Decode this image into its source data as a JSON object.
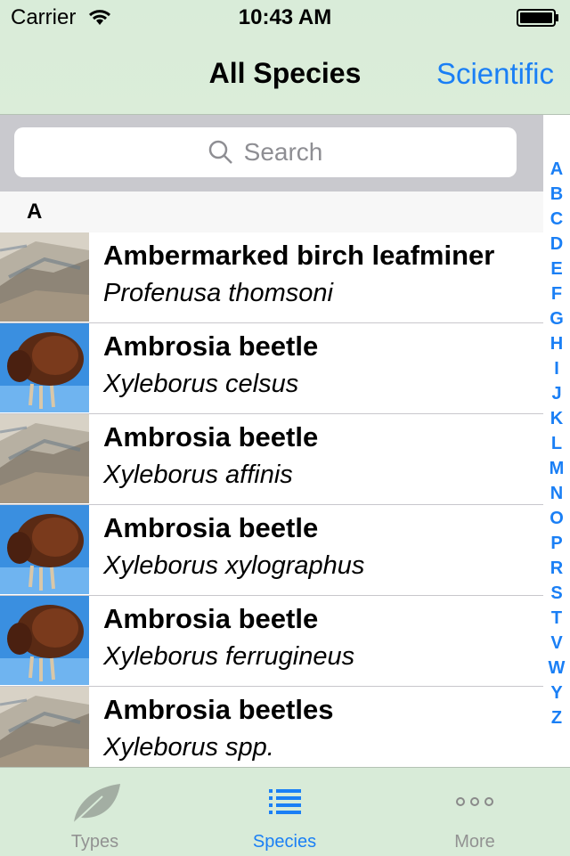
{
  "status_bar": {
    "carrier": "Carrier",
    "time": "10:43 AM"
  },
  "nav": {
    "title": "All Species",
    "right_button": "Scientific"
  },
  "search": {
    "placeholder": "Search"
  },
  "section": {
    "letter": "A"
  },
  "rows": [
    {
      "common": "Ambermarked birch leafminer",
      "scientific": "Profenusa thomsoni",
      "thumb": "landscape"
    },
    {
      "common": "Ambrosia beetle",
      "scientific": "Xyleborus celsus",
      "thumb": "beetle"
    },
    {
      "common": "Ambrosia beetle",
      "scientific": "Xyleborus affinis",
      "thumb": "landscape"
    },
    {
      "common": "Ambrosia beetle",
      "scientific": "Xyleborus xylographus",
      "thumb": "beetle"
    },
    {
      "common": "Ambrosia beetle",
      "scientific": "Xyleborus ferrugineus",
      "thumb": "beetle"
    },
    {
      "common": "Ambrosia beetles",
      "scientific": "Xyleborus spp.",
      "thumb": "landscape"
    }
  ],
  "index_letters": [
    "A",
    "B",
    "C",
    "D",
    "E",
    "F",
    "G",
    "H",
    "I",
    "J",
    "K",
    "L",
    "M",
    "N",
    "O",
    "P",
    "R",
    "S",
    "T",
    "V",
    "W",
    "Y",
    "Z"
  ],
  "tabs": [
    {
      "label": "Types",
      "icon": "leaf-icon",
      "active": false
    },
    {
      "label": "Species",
      "icon": "list-icon",
      "active": true
    },
    {
      "label": "More",
      "icon": "more-dots-icon",
      "active": false
    }
  ],
  "colors": {
    "accent": "#1a7ff5",
    "bar_bg": "#d8ebd8",
    "inactive": "#929292"
  }
}
